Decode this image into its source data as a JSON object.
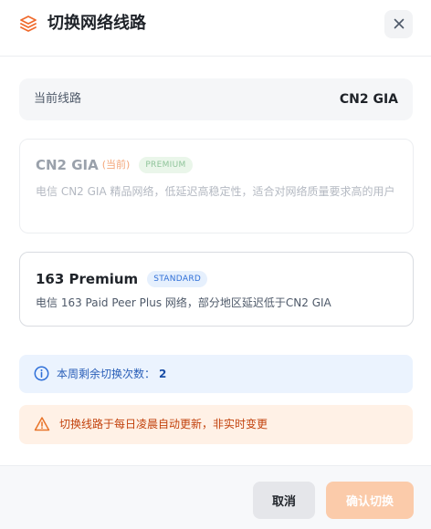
{
  "dialog": {
    "title": "切换网络线路",
    "title_icon": "layers-icon",
    "close_icon": "close-icon"
  },
  "current_route": {
    "label": "当前线路",
    "value": "CN2 GIA"
  },
  "options": [
    {
      "name": "CN2 GIA",
      "current_tag": "(当前)",
      "badge": "PREMIUM",
      "description": "电信 CN2 GIA 精品网络，低延迟高稳定性，适合对网络质量要求高的用户",
      "state": "current-disabled"
    },
    {
      "name": "163 Premium",
      "badge": "STANDARD",
      "description": "电信 163 Paid Peer Plus 网络，部分地区延迟低于CN2 GIA",
      "state": "selectable"
    }
  ],
  "info": {
    "icon": "info-icon",
    "label": "本周剩余切换次数：",
    "count": "2"
  },
  "warning": {
    "icon": "warning-icon",
    "text": "切换线路于每日凌晨自动更新，非实时变更"
  },
  "footer": {
    "cancel_label": "取消",
    "confirm_label": "确认切换"
  },
  "colors": {
    "accent": "#f06a2c",
    "confirm_disabled": "#fbcbaa",
    "info_bg": "#ebf3fe",
    "warning_bg": "#fff1e6"
  }
}
